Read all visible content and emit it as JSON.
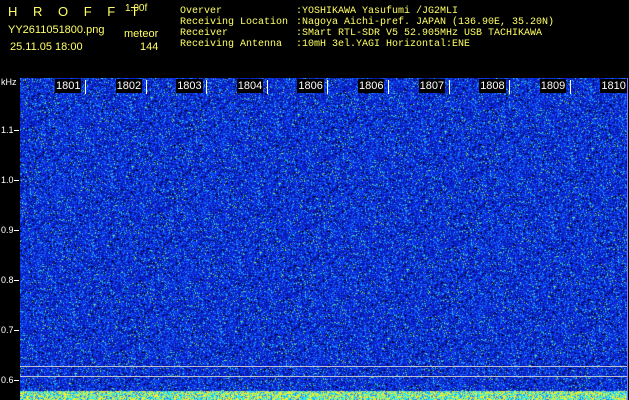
{
  "header": {
    "brand": "H R O F F T",
    "version": "1.00f",
    "filename": "YY2611051800.png",
    "mode": "meteor",
    "datetime": "25.11.05 18:00",
    "count": "144"
  },
  "station": [
    {
      "key": "Overver",
      "value": ":YOSHIKAWA Yasufumi /JG2MLI"
    },
    {
      "key": "Receiving Location",
      "value": ":Nagoya Aichi-pref. JAPAN (136.90E, 35.20N)"
    },
    {
      "key": "Receiver",
      "value": ":SMart RTL-SDR V5 52.905MHz USB TACHIKAWA"
    },
    {
      "key": "Receiving Antenna",
      "value": ":10mH 3el.YAGI Horizontal:ENE"
    }
  ],
  "axis": {
    "unit": "kHz",
    "ticks": [
      {
        "label": "1.1",
        "value": 1.1
      },
      {
        "label": "1.0",
        "value": 1.0
      },
      {
        "label": "0.9",
        "value": 0.9
      },
      {
        "label": "0.8",
        "value": 0.8
      },
      {
        "label": "0.7",
        "value": 0.7
      },
      {
        "label": "0.6",
        "value": 0.6
      }
    ]
  },
  "time_labels": [
    "1801",
    "1802",
    "1803",
    "1804",
    "1806",
    "1806",
    "1807",
    "1808",
    "1809",
    "1810"
  ],
  "colors": {
    "background": "#000000",
    "header_text": "#ffff66",
    "axis_text": "#ffffff",
    "waterfall_base": "#0a24c8"
  }
}
